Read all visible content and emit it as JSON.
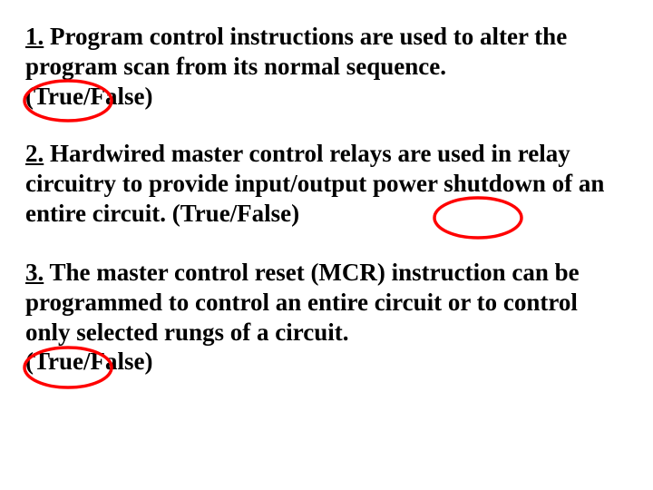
{
  "questions": {
    "q1": {
      "num": "1.",
      "prefix": " Program control instructions are used to alter the program scan from its normal sequence.",
      "tf": "(True/False)"
    },
    "q2": {
      "num": "2.",
      "prefix": " Hardwired master control relays are used in relay circuitry to provide input/output power shutdown of an entire circuit.   ",
      "tf": "(True/False)"
    },
    "q3": {
      "num": "3.",
      "prefix": " The master control reset (MCR) instruction can be programmed to control an entire circuit or to control only selected rungs of a circuit.",
      "tf": "(True/False)"
    }
  }
}
